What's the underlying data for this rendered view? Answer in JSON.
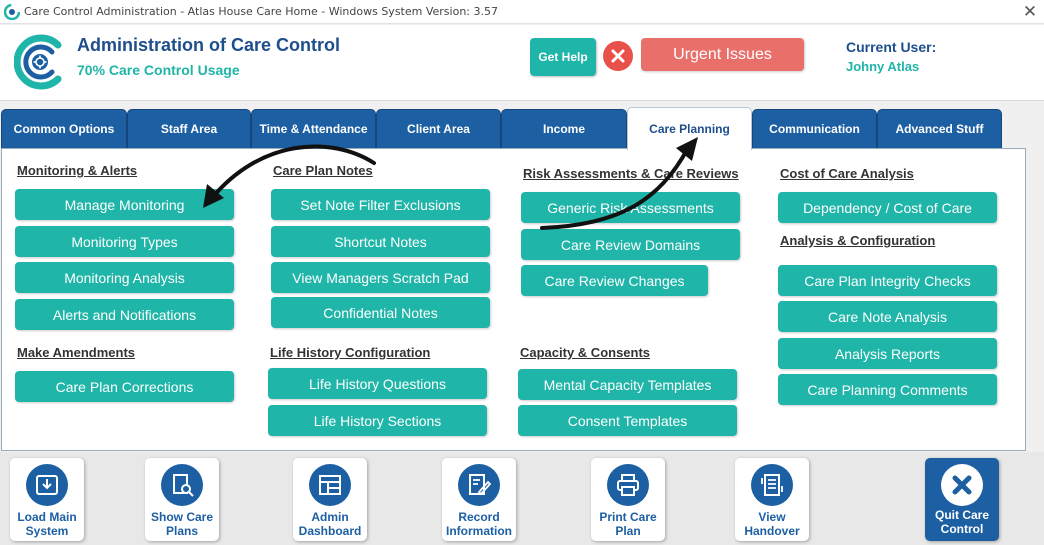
{
  "window": {
    "title": "Care Control Administration - Atlas House Care Home - Windows System Version: 3.57",
    "close_glyph": "✕"
  },
  "header": {
    "title": "Administration of Care Control",
    "subtitle": "70% Care Control Usage",
    "get_help": "Get Help",
    "urgent": "Urgent Issues",
    "current_user_label": "Current User:",
    "current_user_name": "Johny Atlas"
  },
  "tabs": [
    {
      "label": "Common Options"
    },
    {
      "label": "Staff Area"
    },
    {
      "label": "Time & Attendance"
    },
    {
      "label": "Client Area"
    },
    {
      "label": "Income"
    },
    {
      "label": "Care Planning",
      "active": true
    },
    {
      "label": "Communication"
    },
    {
      "label": "Advanced Stuff"
    }
  ],
  "panel": {
    "col1": {
      "monitoring_heading": "Monitoring & Alerts",
      "monitoring": [
        "Manage Monitoring",
        "Monitoring Types",
        "Monitoring Analysis",
        "Alerts and Notifications"
      ],
      "amendments_heading": "Make Amendments",
      "amendments": [
        "Care Plan Corrections"
      ]
    },
    "col2": {
      "notes_heading": "Care Plan Notes",
      "notes": [
        "Set Note Filter Exclusions",
        "Shortcut Notes",
        "View Managers Scratch Pad",
        "Confidential Notes"
      ],
      "life_heading": "Life History Configuration",
      "life": [
        "Life History Questions",
        "Life History Sections"
      ]
    },
    "col3": {
      "risk_heading": "Risk Assessments & Care Reviews",
      "risk": [
        "Generic Risk Assessments",
        "Care Review Domains",
        "Care Review Changes"
      ],
      "capacity_heading": "Capacity & Consents",
      "capacity": [
        "Mental Capacity Templates",
        "Consent Templates"
      ]
    },
    "col4": {
      "cost_heading": "Cost of Care Analysis",
      "cost": [
        "Dependency / Cost of Care"
      ],
      "analysis_heading": "Analysis & Configuration",
      "analysis": [
        "Care Plan Integrity Checks",
        "Care Note Analysis",
        "Analysis Reports",
        "Care Planning Comments"
      ]
    }
  },
  "toolbar": [
    {
      "line1": "Load Main",
      "line2": "System",
      "icon": "download-box-icon"
    },
    {
      "line1": "Show Care",
      "line2": "Plans",
      "icon": "document-search-icon"
    },
    {
      "line1": "Admin",
      "line2": "Dashboard",
      "icon": "dashboard-icon"
    },
    {
      "line1": "Record",
      "line2": "Information",
      "icon": "edit-document-icon"
    },
    {
      "line1": "Print Care",
      "line2": "Plan",
      "icon": "printer-icon"
    },
    {
      "line1": "View",
      "line2": "Handover",
      "icon": "handover-list-icon"
    },
    {
      "line1": "Quit Care",
      "line2": "Control",
      "icon": "close-circle-icon"
    }
  ],
  "colors": {
    "teal": "#1fb5a8",
    "navy": "#1c5fa3",
    "urgent": "#e9706a",
    "danger": "#e8504a"
  }
}
